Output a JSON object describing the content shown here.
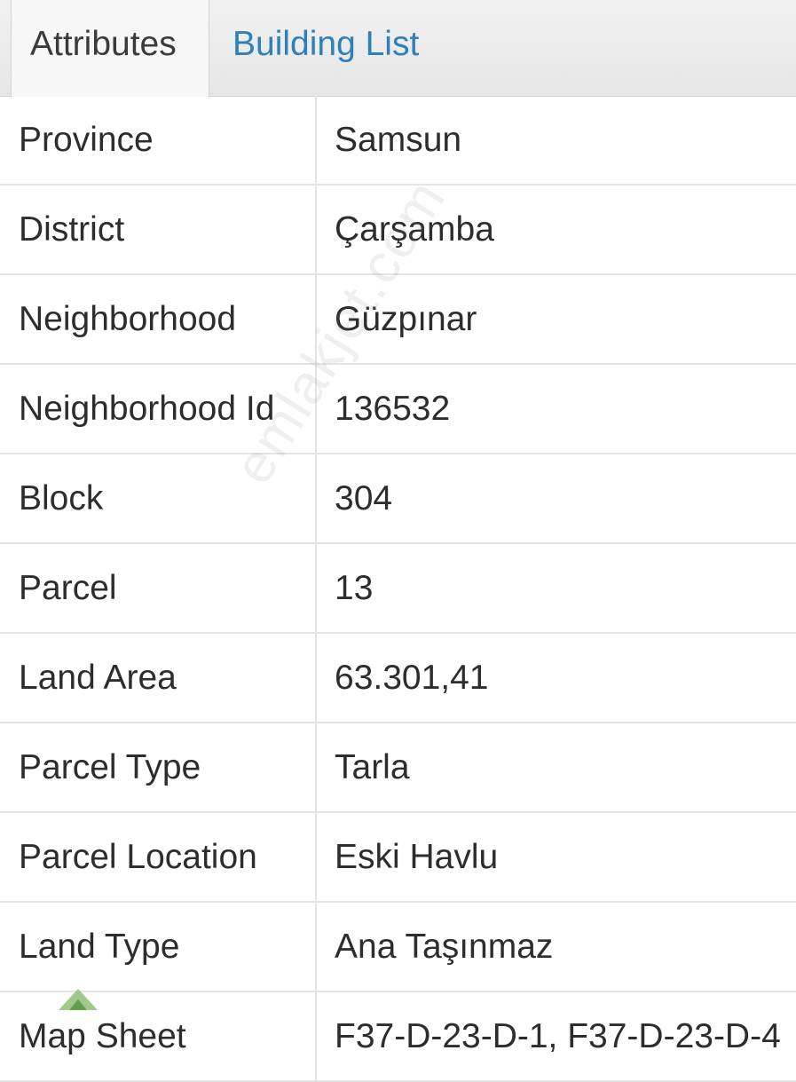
{
  "tabs": [
    {
      "label": "Attributes",
      "active": true
    },
    {
      "label": "Building List",
      "active": false
    }
  ],
  "rows": [
    {
      "key": "Province",
      "value": "Samsun"
    },
    {
      "key": "District",
      "value": "Çarşamba"
    },
    {
      "key": "Neighborhood",
      "value": "Güzpınar"
    },
    {
      "key": "Neighborhood Id",
      "value": "136532"
    },
    {
      "key": "Block",
      "value": "304"
    },
    {
      "key": "Parcel",
      "value": "13"
    },
    {
      "key": "Land Area",
      "value": "63.301,41"
    },
    {
      "key": "Parcel Type",
      "value": "Tarla"
    },
    {
      "key": "Parcel Location",
      "value": "Eski Havlu"
    },
    {
      "key": "Land Type",
      "value": "Ana Taşınmaz"
    },
    {
      "key": "Map Sheet",
      "value": "F37-D-23-D-1, F37-D-23-D-4"
    }
  ],
  "watermark": "emlakjet.com",
  "colors": {
    "tab_link": "#2f7fb8",
    "text": "#2d2d2d",
    "border": "#e4e4e4"
  },
  "icons": {
    "house_logo": "house-logo-icon"
  }
}
